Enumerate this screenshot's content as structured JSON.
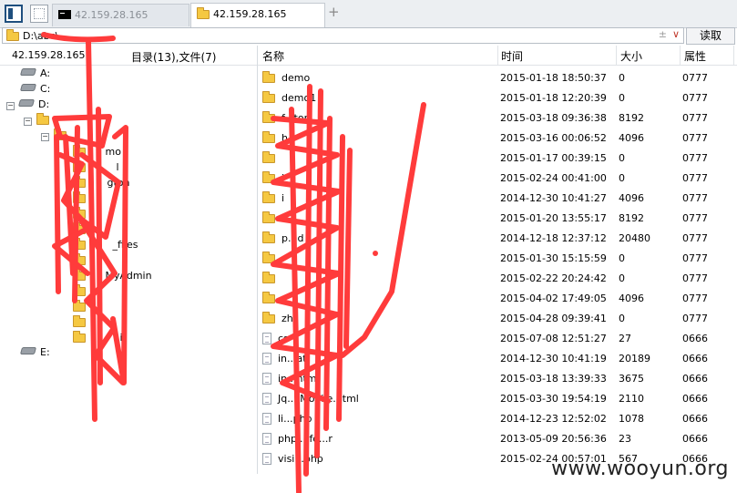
{
  "tabs": [
    {
      "label": "42.159.28.165",
      "kind": "terminal",
      "active": false
    },
    {
      "label": "42.159.28.165",
      "kind": "folder",
      "active": true
    }
  ],
  "tab_add": "+",
  "address": {
    "path": "D:\\abc\\",
    "ctrl": "±",
    "chevron": "∨"
  },
  "read_button": "读取",
  "left_pane": {
    "host": "42.159.28.165",
    "count": "目录(13),文件(7)",
    "drives": [
      "A:",
      "C:",
      "D:",
      "E:"
    ],
    "expanders": {
      "collapse": "−",
      "expand": "+"
    },
    "tree_visible_fragments": [
      "mo",
      "l",
      "gton",
      "_files",
      "MyAdmin",
      "i"
    ]
  },
  "columns": {
    "name": "名称",
    "time": "时间",
    "size": "大小",
    "attr": "属性"
  },
  "files": [
    {
      "name": "demo",
      "type": "folder",
      "time": "2015-01-18 18:50:37",
      "size": "0",
      "attr": "0777"
    },
    {
      "name": "demo1",
      "type": "folder",
      "time": "2015-01-18 12:20:39",
      "size": "0",
      "attr": "0777"
    },
    {
      "name": "f...ton",
      "type": "folder",
      "time": "2015-03-18 09:36:38",
      "size": "8192",
      "attr": "0777"
    },
    {
      "name": "h",
      "type": "folder",
      "time": "2015-03-16 00:06:52",
      "size": "4096",
      "attr": "0777"
    },
    {
      "name": "",
      "type": "folder",
      "time": "2015-01-17 00:39:15",
      "size": "0",
      "attr": "0777"
    },
    {
      "name": "i",
      "type": "folder",
      "time": "2015-02-24 00:41:00",
      "size": "0",
      "attr": "0777"
    },
    {
      "name": "i",
      "type": "folder",
      "time": "2014-12-30 10:41:27",
      "size": "4096",
      "attr": "0777"
    },
    {
      "name": "l",
      "type": "folder",
      "time": "2015-01-20 13:55:17",
      "size": "8192",
      "attr": "0777"
    },
    {
      "name": "p...d",
      "type": "folder",
      "time": "2014-12-18 12:37:12",
      "size": "20480",
      "attr": "0777"
    },
    {
      "name": "",
      "type": "folder",
      "time": "2015-01-30 15:15:59",
      "size": "0",
      "attr": "0777"
    },
    {
      "name": "",
      "type": "folder",
      "time": "2015-02-22 20:24:42",
      "size": "0",
      "attr": "0777"
    },
    {
      "name": "x",
      "type": "folder",
      "time": "2015-04-02 17:49:05",
      "size": "4096",
      "attr": "0777"
    },
    {
      "name": "zh",
      "type": "folder",
      "time": "2015-04-28 09:39:41",
      "size": "0",
      "attr": "0777"
    },
    {
      "name": "cs",
      "type": "file",
      "time": "2015-07-08 12:51:27",
      "size": "27",
      "attr": "0666"
    },
    {
      "name": "in...at",
      "type": "file",
      "time": "2014-12-30 10:41:19",
      "size": "20189",
      "attr": "0666"
    },
    {
      "name": "in...html",
      "type": "file",
      "time": "2015-03-18 13:39:33",
      "size": "3675",
      "attr": "0666"
    },
    {
      "name": "Jq... Mobile.html",
      "type": "file",
      "time": "2015-03-30 19:54:19",
      "size": "2110",
      "attr": "0666"
    },
    {
      "name": "li...php",
      "type": "file",
      "time": "2014-12-23 12:52:02",
      "size": "1078",
      "attr": "0666"
    },
    {
      "name": "phpi...fo...r",
      "type": "file",
      "time": "2013-05-09 20:56:36",
      "size": "23",
      "attr": "0666"
    },
    {
      "name": "visi...php",
      "type": "file",
      "time": "2015-02-24 00:57:01",
      "size": "567",
      "attr": "0666"
    }
  ],
  "watermark": "www.wooyun.org",
  "colors": {
    "scribble": "#ff3b3b",
    "folder": "#f5c842",
    "accent": "#1f4f7e"
  }
}
